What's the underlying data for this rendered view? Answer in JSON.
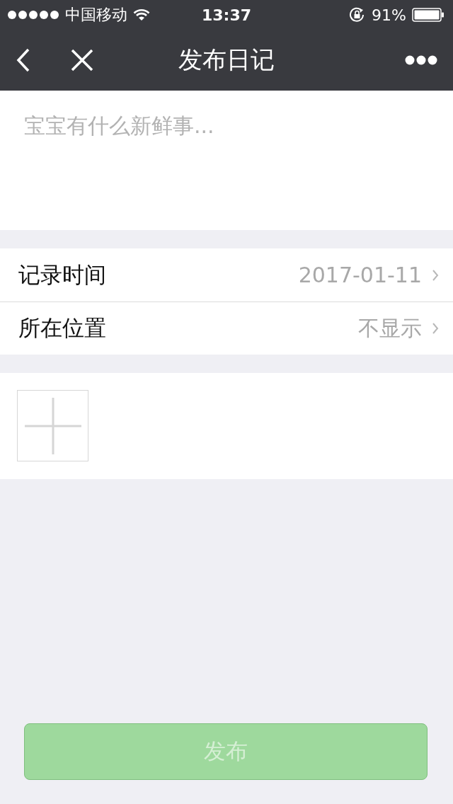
{
  "status_bar": {
    "carrier": "中国移动",
    "time": "13:37",
    "battery_percent": "91%"
  },
  "nav": {
    "title": "发布日记"
  },
  "diary": {
    "placeholder": "宝宝有什么新鲜事..."
  },
  "fields": [
    {
      "label": "记录时间",
      "value": "2017-01-11"
    },
    {
      "label": "所在位置",
      "value": "不显示"
    }
  ],
  "publish_button": {
    "label": "发布",
    "disabled": true
  }
}
